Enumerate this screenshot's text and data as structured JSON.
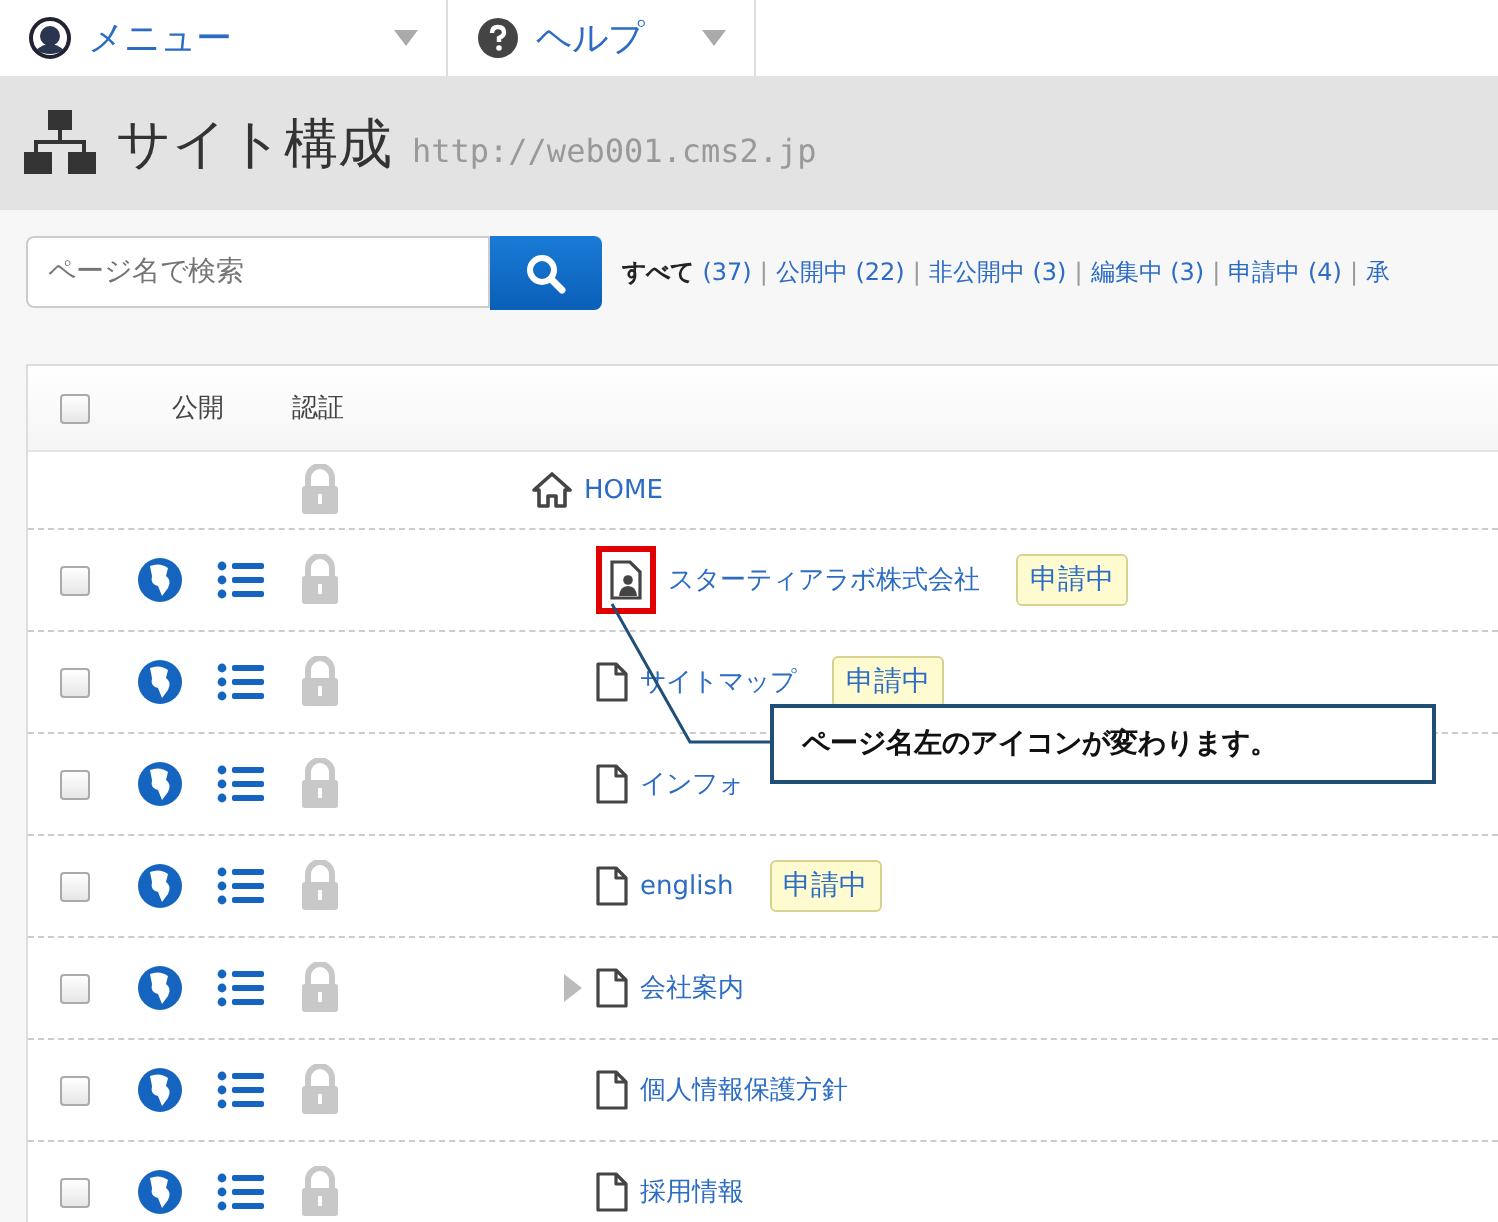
{
  "menu": [
    {
      "label": "メニュー",
      "kind": "menu"
    },
    {
      "label": "ヘルプ",
      "kind": "help"
    }
  ],
  "title": {
    "text": "サイト構成",
    "url": "http://web001.cms2.jp"
  },
  "search": {
    "placeholder": "ページ名で検索"
  },
  "filters": [
    {
      "label": "すべて",
      "count": "(37)",
      "selected": true
    },
    {
      "sep": "|",
      "label": "公開中",
      "count": "(22)",
      "selected": false
    },
    {
      "sep": "|",
      "label": "非公開中",
      "count": "(3)",
      "selected": false
    },
    {
      "sep": "|",
      "label": "編集中",
      "count": "(3)",
      "selected": false
    },
    {
      "sep": "|",
      "label": "申請中",
      "count": "(4)",
      "selected": false
    },
    {
      "sep": "|",
      "label": "承",
      "selected": false
    }
  ],
  "table": {
    "header_checked": false,
    "columns": [
      "公開",
      "認証"
    ],
    "tree": {
      "name": "HOME",
      "kind": "home",
      "children": [
        {
          "name": "スターティアラボ株式会社",
          "kind": "person",
          "badge": "申請中",
          "checked": false,
          "collapsible": false,
          "highlighted": true
        },
        {
          "name": "サイトマップ",
          "kind": "page",
          "badge": "申請中",
          "checked": false,
          "collapsible": false,
          "highlighted": false
        },
        {
          "name": "インフォ",
          "kind": "page",
          "checked": false,
          "collapsible": false,
          "highlighted": false
        },
        {
          "name": "english",
          "kind": "page",
          "badge": "申請中",
          "checked": false,
          "collapsible": false,
          "highlighted": false
        },
        {
          "name": "会社案内",
          "kind": "page",
          "checked": false,
          "collapsible": true,
          "highlighted": false
        },
        {
          "name": "個人情報保護方針",
          "kind": "page",
          "checked": false,
          "collapsible": false,
          "highlighted": false
        },
        {
          "name": "採用情報",
          "kind": "page",
          "checked": false,
          "collapsible": false,
          "highlighted": false
        }
      ]
    }
  },
  "callout": {
    "text": "ページ名左のアイコンが変わります。"
  }
}
